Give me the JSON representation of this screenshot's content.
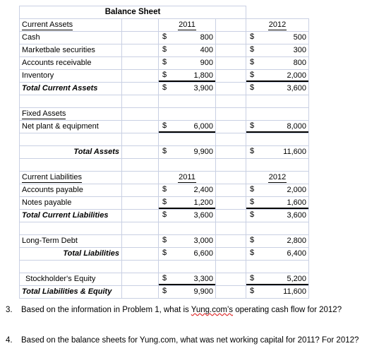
{
  "sheet": {
    "title": "Balance Sheet",
    "columns": {
      "label": "",
      "spacer1": "",
      "year1": "2011",
      "spacer2": "",
      "year2": "2012"
    },
    "dollar_symbol": "$",
    "sections": {
      "current_assets_header": "Current Assets",
      "fixed_assets_header": "Fixed Assets",
      "current_liabilities_header": "Current Liabilities"
    },
    "rows": [
      {
        "label": "Cash",
        "v2011": "800",
        "v2012": "500",
        "style": "plain"
      },
      {
        "label": "Marketbale securities",
        "v2011": "400",
        "v2012": "300",
        "style": "plain"
      },
      {
        "label": "Accounts receivable",
        "v2011": "900",
        "v2012": "800",
        "style": "plain"
      },
      {
        "label": "Inventory",
        "v2011": "1,800",
        "v2012": "2,000",
        "style": "ruled"
      },
      {
        "label": "Total Current Assets",
        "v2011": "3,900",
        "v2012": "3,600",
        "style": "subtotal-indent"
      },
      {
        "label": "Net plant & equipment",
        "v2011": "6,000",
        "v2012": "8,000",
        "style": "ruled"
      },
      {
        "label": "Total Assets",
        "v2011": "9,900",
        "v2012": "11,600",
        "style": "total-right"
      },
      {
        "label": "Accounts payable",
        "v2011": "2,400",
        "v2012": "2,000",
        "style": "plain"
      },
      {
        "label": "Notes payable",
        "v2011": "1,200",
        "v2012": "1,600",
        "style": "ruled"
      },
      {
        "label": "Total Current Liabilities",
        "v2011": "3,600",
        "v2012": "3,600",
        "style": "subtotal-indent"
      },
      {
        "label": "Long-Term Debt",
        "v2011": "3,000",
        "v2012": "2,800",
        "style": "plain"
      },
      {
        "label": "Total Liabilities",
        "v2011": "6,600",
        "v2012": "6,400",
        "style": "total-right"
      },
      {
        "label": "Stockholder's Equity",
        "v2011": "3,300",
        "v2012": "5,200",
        "style": "ruled-indent"
      },
      {
        "label": "Total Liabilities & Equity",
        "v2011": "9,900",
        "v2012": "11,600",
        "style": "grand-total"
      }
    ]
  },
  "questions": [
    {
      "number": "3.",
      "text_before": "Based on the information in Problem 1, what is ",
      "flagged": "Yung.com’s",
      "text_after": " operating cash flow for 2012?"
    },
    {
      "number": "4.",
      "text_before": "Based on the balance sheets for Yung.com, what was net working capital for 2011?  For 2012?",
      "flagged": "",
      "text_after": ""
    }
  ]
}
